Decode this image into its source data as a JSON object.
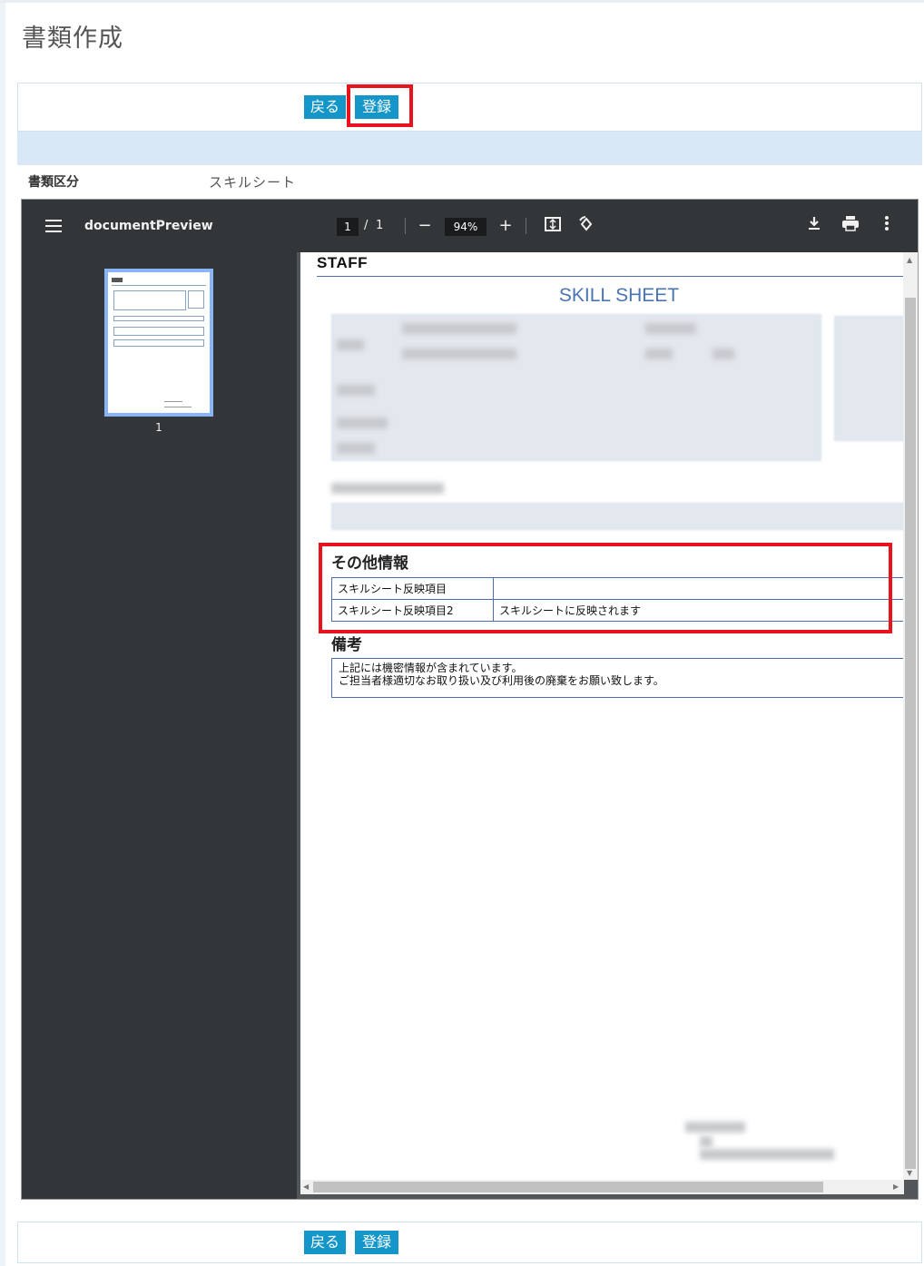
{
  "page": {
    "title": "書類作成"
  },
  "actions": {
    "back_label": "戻る",
    "register_label": "登録"
  },
  "form": {
    "doc_type_label": "書類区分",
    "doc_type_value": "スキルシート"
  },
  "viewer": {
    "filename": "documentPreview",
    "current_page": "1",
    "page_separator": "/",
    "total_pages": "1",
    "zoom": "94%",
    "zoom_out_symbol": "−",
    "zoom_in_symbol": "+",
    "thumbnail_label": "1"
  },
  "document": {
    "logo_text": "STAFF",
    "sheet_title": "SKILL SHEET",
    "other_info_title": "その他情報",
    "other_info_rows": [
      {
        "label": "スキルシート反映項目",
        "value": ""
      },
      {
        "label": "スキルシート反映項目2",
        "value": "スキルシートに反映されます"
      }
    ],
    "remarks_title": "備考",
    "remarks_line1": "上記には機密情報が含まれています。",
    "remarks_line2": "ご担当者様適切なお取り扱い及び利用後の廃棄をお願い致します。"
  },
  "colors": {
    "accent": "#1496c9",
    "highlight": "#e8131d",
    "viewer_toolbar": "#323639",
    "doc_blue": "#4a74b4"
  }
}
